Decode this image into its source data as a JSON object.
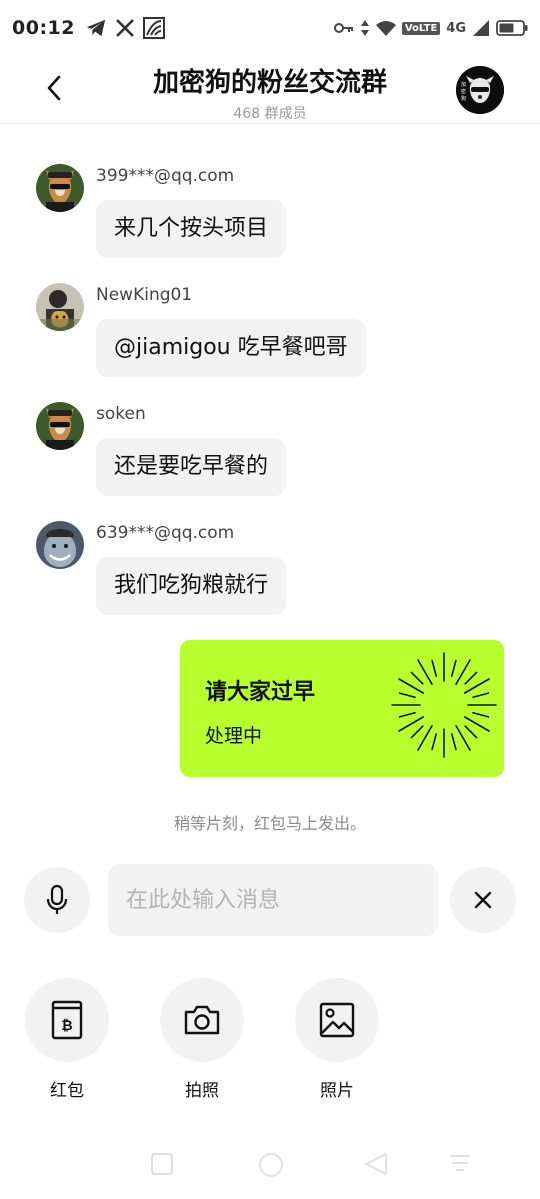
{
  "status_bar": {
    "time": "00:12",
    "network_label": "VoLTE",
    "network_type": "4G",
    "icons": [
      "telegram-icon",
      "x-icon",
      "app-icon",
      "vpn-key-icon",
      "data-arrows-icon",
      "wifi-icon",
      "signal-icon",
      "battery-icon"
    ]
  },
  "header": {
    "title": "加密狗的粉丝交流群",
    "member_count": "468 群成员"
  },
  "messages": [
    {
      "sender": "399***@qq.com",
      "text": "来几个按头项目",
      "avatar_color": "#5a4a2a"
    },
    {
      "sender": "NewKing01",
      "text": "@jiamigou 吃早餐吧哥",
      "avatar_color": "#8a7a5a"
    },
    {
      "sender": "soken",
      "text": "还是要吃早餐的",
      "avatar_color": "#5a4a2a"
    },
    {
      "sender": "639***@qq.com",
      "text": "我们吃狗粮就行",
      "avatar_color": "#3a4a5a"
    }
  ],
  "red_packet": {
    "title": "请大家过早",
    "status": "处理中",
    "color": "#b8ff2e"
  },
  "notice": "稍等片刻，红包马上发出。",
  "input": {
    "placeholder": "在此处输入消息"
  },
  "tools": [
    {
      "label": "红包",
      "icon": "red-packet-bitcoin-icon"
    },
    {
      "label": "拍照",
      "icon": "camera-icon"
    },
    {
      "label": "照片",
      "icon": "image-icon"
    }
  ]
}
